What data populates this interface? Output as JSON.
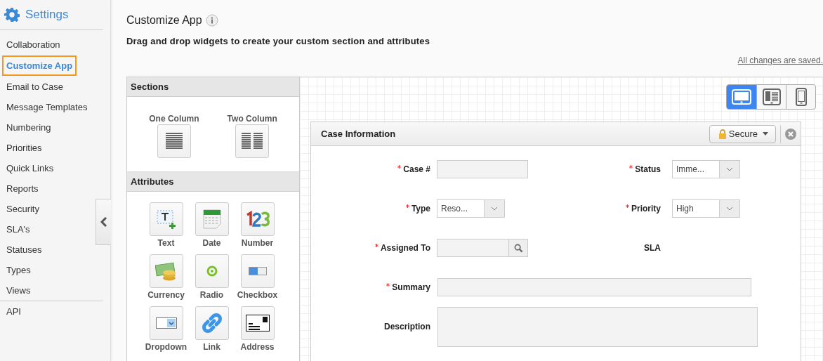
{
  "sidebar": {
    "title": "Settings",
    "items": [
      {
        "label": "Collaboration",
        "selected": false
      },
      {
        "label": "Customize App",
        "selected": true
      },
      {
        "label": "Email to Case",
        "selected": false
      },
      {
        "label": "Message Templates",
        "selected": false
      },
      {
        "label": "Numbering",
        "selected": false
      },
      {
        "label": "Priorities",
        "selected": false
      },
      {
        "label": "Quick Links",
        "selected": false
      },
      {
        "label": "Reports",
        "selected": false
      },
      {
        "label": "Security",
        "selected": false
      },
      {
        "label": "SLA's",
        "selected": false
      },
      {
        "label": "Statuses",
        "selected": false
      },
      {
        "label": "Types",
        "selected": false
      },
      {
        "label": "Views",
        "selected": false
      }
    ],
    "footer_items": [
      {
        "label": "API",
        "selected": false
      }
    ]
  },
  "page": {
    "title": "Customize App",
    "subtitle": "Drag and drop widgets to create your custom section and attributes",
    "save_status": "All changes are saved."
  },
  "palette": {
    "sections": {
      "title": "Sections",
      "items": [
        {
          "label": "One Column",
          "kind": "one-column"
        },
        {
          "label": "Two Column",
          "kind": "two-column"
        }
      ]
    },
    "attributes": {
      "title": "Attributes",
      "items": [
        {
          "label": "Text",
          "kind": "text"
        },
        {
          "label": "Date",
          "kind": "date"
        },
        {
          "label": "Number",
          "kind": "number"
        },
        {
          "label": "Currency",
          "kind": "currency"
        },
        {
          "label": "Radio",
          "kind": "radio"
        },
        {
          "label": "Checkbox",
          "kind": "checkbox"
        },
        {
          "label": "Dropdown",
          "kind": "dropdown"
        },
        {
          "label": "Link",
          "kind": "link"
        },
        {
          "label": "Address",
          "kind": "address"
        }
      ]
    }
  },
  "device_toggle": [
    {
      "kind": "desktop",
      "selected": true
    },
    {
      "kind": "tablet",
      "selected": false
    },
    {
      "kind": "phone",
      "selected": false
    }
  ],
  "section_card": {
    "title": "Case Information",
    "security_button": "Secure",
    "rows": [
      [
        {
          "label": "Case #",
          "required": true,
          "kind": "text"
        },
        {
          "label": "Status",
          "required": true,
          "kind": "select",
          "value": "Imme..."
        }
      ],
      [
        {
          "label": "Type",
          "required": true,
          "kind": "select",
          "value": "Reso..."
        },
        {
          "label": "Priority",
          "required": true,
          "kind": "select",
          "value": "High"
        }
      ],
      [
        {
          "label": "Assigned To",
          "required": true,
          "kind": "lookup"
        },
        {
          "label": "SLA",
          "required": false,
          "kind": "readonly"
        }
      ],
      [
        {
          "label": "Summary",
          "required": true,
          "kind": "wide"
        }
      ],
      [
        {
          "label": "Description",
          "required": false,
          "kind": "textarea"
        }
      ]
    ]
  }
}
